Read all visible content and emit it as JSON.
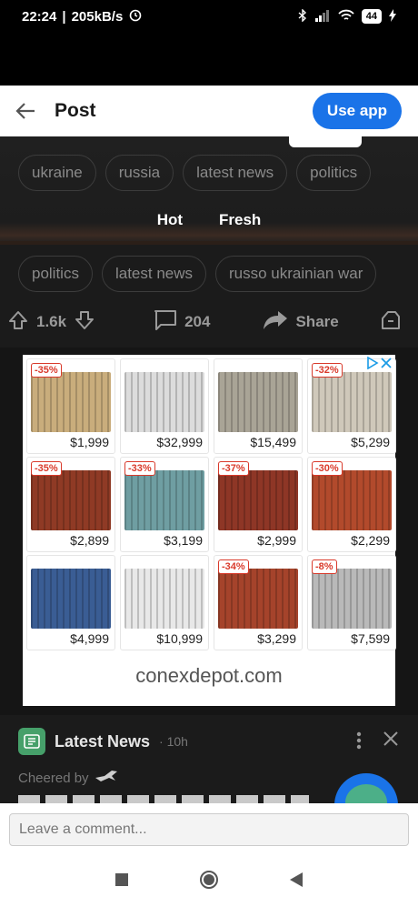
{
  "status_bar": {
    "time": "22:24",
    "speed": "205kB/s",
    "battery": "44"
  },
  "header": {
    "title": "Post",
    "use_app_label": "Use app"
  },
  "top_tags": [
    "ukraine",
    "russia",
    "latest news",
    "politics"
  ],
  "sort_tabs": {
    "hot": "Hot",
    "fresh": "Fresh"
  },
  "post_tags": [
    "politics",
    "latest news",
    "russo ukrainian war"
  ],
  "actions": {
    "votes": "1.6k",
    "comments": "204",
    "share_label": "Share"
  },
  "ad": {
    "domain": "conexdepot.com",
    "items": [
      {
        "discount": "-35%",
        "price": "$1,999",
        "color": "#c9ad7c"
      },
      {
        "discount": "",
        "price": "$32,999",
        "color": "#dcdcdc"
      },
      {
        "discount": "",
        "price": "$15,499",
        "color": "#a9a496"
      },
      {
        "discount": "-32%",
        "price": "$5,299",
        "color": "#cfc8ba"
      },
      {
        "discount": "-35%",
        "price": "$2,899",
        "color": "#8f3a25"
      },
      {
        "discount": "-33%",
        "price": "$3,199",
        "color": "#6f9ea2"
      },
      {
        "discount": "-37%",
        "price": "$2,999",
        "color": "#8e3626"
      },
      {
        "discount": "-30%",
        "price": "$2,299",
        "color": "#b24a2c"
      },
      {
        "discount": "",
        "price": "$4,999",
        "color": "#3a5d94"
      },
      {
        "discount": "",
        "price": "$10,999",
        "color": "#e8e8e8"
      },
      {
        "discount": "-34%",
        "price": "$3,299",
        "color": "#a5432b"
      },
      {
        "discount": "-8%",
        "price": "$7,599",
        "color": "#b9b9b9"
      }
    ]
  },
  "news": {
    "title": "Latest News",
    "time": "· 10h",
    "cheered_by": "Cheered by"
  },
  "comment": {
    "placeholder": "Leave a comment..."
  },
  "colors": {
    "accent": "#1a73e8",
    "background": "#1b1b1b",
    "discount": "#d93a2b"
  }
}
